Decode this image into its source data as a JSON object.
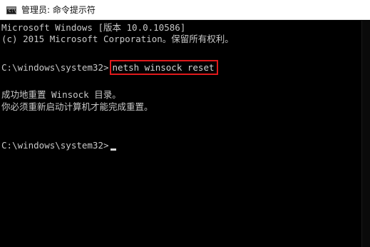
{
  "window": {
    "title": "管理员: 命令提示符",
    "icon": "cmd-icon"
  },
  "console": {
    "line1": "Microsoft Windows [版本 10.0.10586]",
    "line2": "(c) 2015 Microsoft Corporation。保留所有权利。",
    "prompt1": "C:\\windows\\system32>",
    "command": "netsh winsock reset",
    "line4": "成功地重置 Winsock 目录。",
    "line5": "你必须重新启动计算机才能完成重置。",
    "prompt2": "C:\\windows\\system32>"
  },
  "colors": {
    "background": "#000000",
    "text": "#c8c8c8",
    "highlight_border": "#e0191b"
  }
}
